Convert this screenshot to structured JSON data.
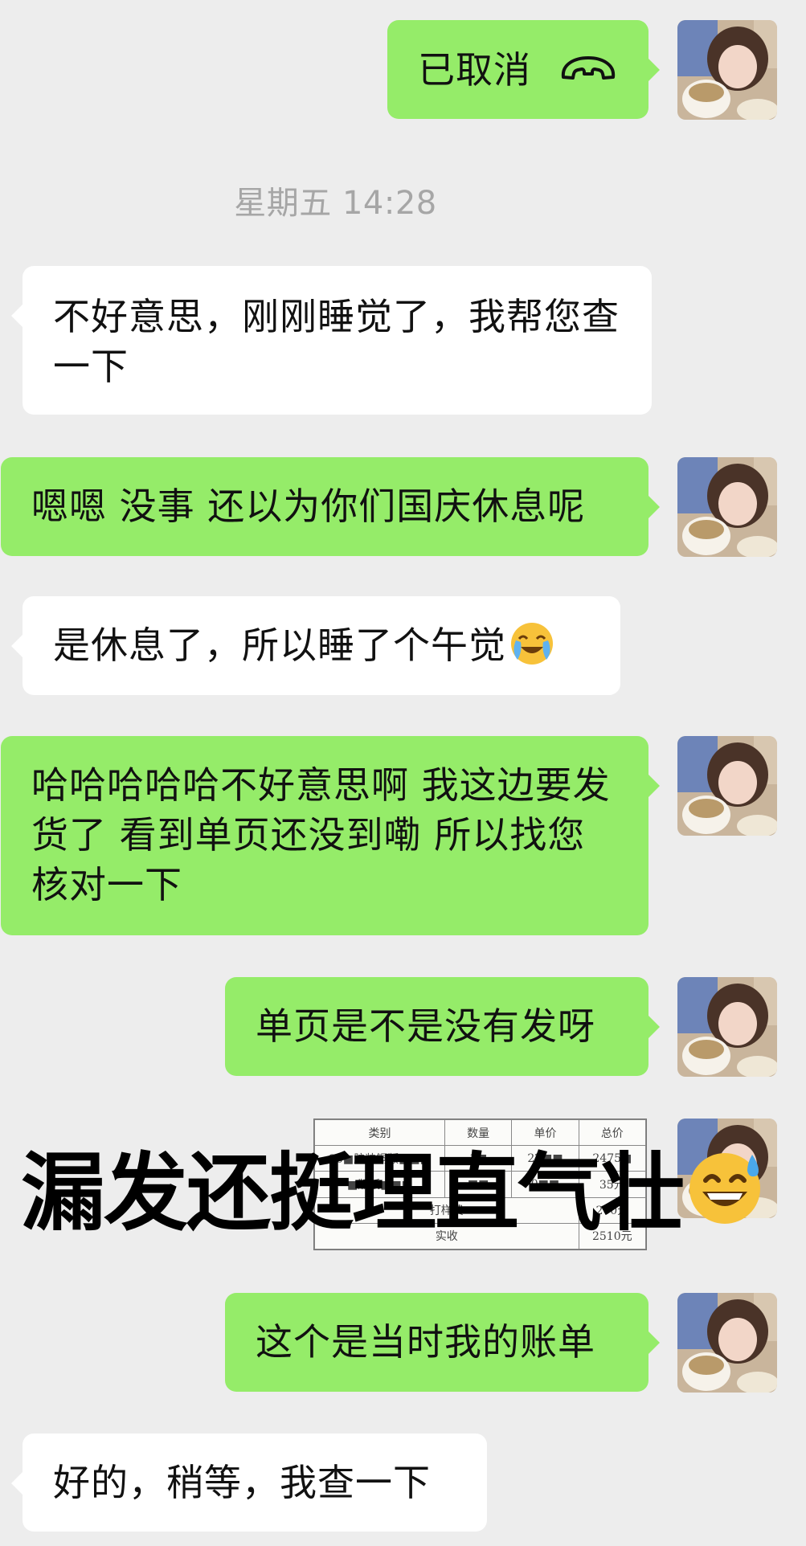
{
  "call": {
    "label": "已取消",
    "icon": "phone-hangup-icon"
  },
  "timestamp": "星期五 14:28",
  "messages": [
    {
      "sender": "them",
      "text": "不好意思，刚刚睡觉了，我帮您查一下"
    },
    {
      "sender": "me",
      "text": "嗯嗯 没事 还以为你们国庆休息呢"
    },
    {
      "sender": "them",
      "text": "是休息了，所以睡了个午觉",
      "emoji": "loudly-crying-laughing-icon"
    },
    {
      "sender": "me",
      "text": "哈哈哈哈哈不好意思啊 我这边要发货了 看到单页还没到嘞 所以找您核对一下"
    },
    {
      "sender": "me",
      "text": "单页是不是没有发呀"
    },
    {
      "sender": "me",
      "text": "这个是当时我的账单"
    },
    {
      "sender": "them",
      "text": "好的，稍等，我查一下"
    }
  ],
  "receipt": {
    "headers": [
      "类别",
      "数量",
      "单价",
      "总价"
    ],
    "rows": [
      [
        "30■胶装铜版■■■",
        "1■",
        "22■■",
        "2475■"
      ],
      [
        "■版纸■■■",
        "■■",
        "0■■",
        "35元"
      ],
      [
        "打样费",
        "",
        "",
        "200元"
      ],
      [
        "实收",
        "",
        "",
        "2510元"
      ]
    ]
  },
  "overlay": {
    "text": "漏发还挺理直气壮",
    "emoji": "grinning-sweat-icon"
  },
  "colors": {
    "background": "#ededed",
    "my_bubble": "#95ec69",
    "their_bubble": "#ffffff",
    "timestamp": "#a6a6a6"
  }
}
